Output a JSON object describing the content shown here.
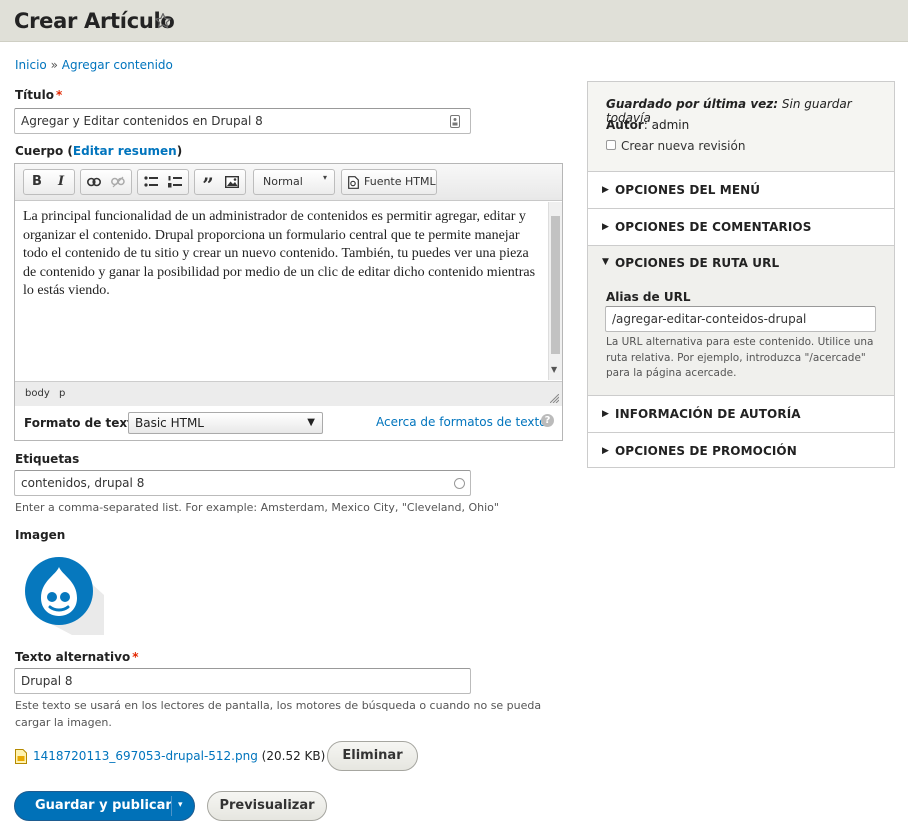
{
  "header": {
    "title": "Crear Artículo"
  },
  "breadcrumb": {
    "home": "Inicio",
    "sep": "»",
    "current": "Agregar contenido"
  },
  "titulo": {
    "label": "Título",
    "value": "Agregar y Editar contenidos en Drupal 8"
  },
  "cuerpo": {
    "label": "Cuerpo",
    "summary_link": "Editar resumen",
    "toolbar": {
      "bold": "B",
      "italic": "I",
      "format_select": "Normal",
      "source_button": "Fuente HTML"
    },
    "text": "La principal funcionalidad de un administrador de contenidos es permitir agregar, editar y organizar el contenido. Drupal proporciona un formulario central que te permite manejar todo el contenido de tu sitio y crear un nuevo contenido. También, tu puedes ver una pieza de contenido y ganar la posibilidad por medio de un clic de editar dicho contenido mientras lo estás viendo.",
    "path": [
      "body",
      "p"
    ]
  },
  "text_format": {
    "label": "Formato de texto",
    "value": "Basic HTML",
    "help_link": "Acerca de formatos de texto"
  },
  "etiquetas": {
    "label": "Etiquetas",
    "value": "contenidos, drupal 8",
    "description": "Enter a comma-separated list. For example: Amsterdam, Mexico City, \"Cleveland, Ohio\""
  },
  "imagen": {
    "label": "Imagen"
  },
  "alt": {
    "label": "Texto alternativo",
    "value": "Drupal 8",
    "description_line1": "Este texto se usará en los lectores de pantalla, los motores de búsqueda o cuando no se pueda",
    "description_line2": "cargar la imagen."
  },
  "file": {
    "name": "1418720113_697053-drupal-512.png",
    "size": "(20.52 KB)",
    "remove_button": "Eliminar"
  },
  "actions": {
    "save": "Guardar y publicar",
    "preview": "Previsualizar"
  },
  "sidebar": {
    "saved_label": "Guardado por última vez:",
    "saved_value": "Sin guardar todavía",
    "author_label": "Autor",
    "author_value": "admin",
    "revision_label": "Crear nueva revisión",
    "sections": {
      "menu": "OPCIONES DEL MENÚ",
      "comments": "OPCIONES DE COMENTARIOS",
      "url": "OPCIONES DE RUTA URL",
      "authoring": "INFORMACIÓN DE AUTORÍA",
      "promotion": "OPCIONES DE PROMOCIÓN"
    },
    "url_alias": {
      "label": "Alias de URL",
      "value": "/agregar-editar-conteidos-drupal",
      "description": "La URL alternativa para este contenido. Utilice una ruta relativa. Por ejemplo, introduzca \"/acercade\" para la página acercade."
    }
  },
  "colors": {
    "accent": "#0074bd",
    "primary_button": "#0071b8",
    "required": "#e32700",
    "drupal_blue": "#0678be"
  }
}
